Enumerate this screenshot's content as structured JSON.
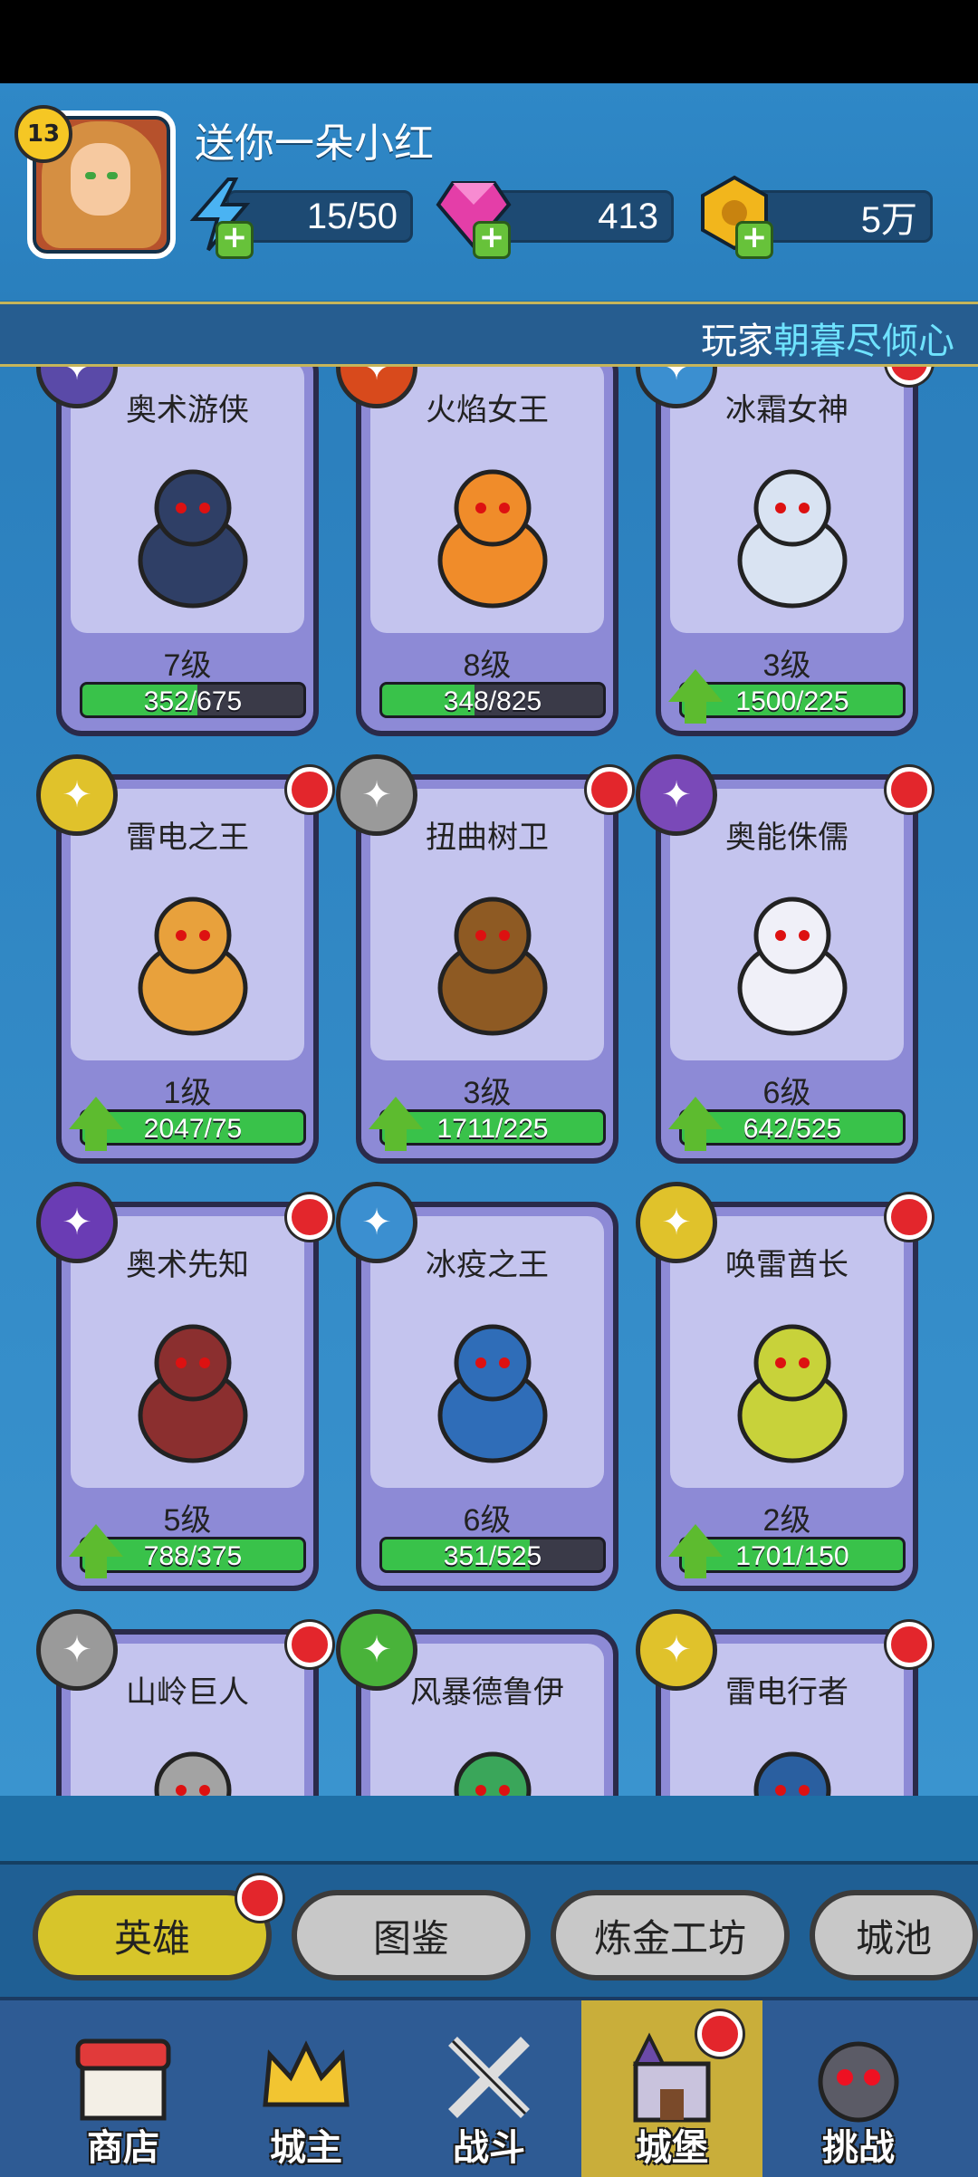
{
  "player": {
    "level": "13",
    "name": "送你一朵小红",
    "energy": "15/50",
    "gems": "413",
    "gold": "5万"
  },
  "ticker": {
    "prefix": "玩家",
    "highlight": "朝暮尽倾心"
  },
  "heroes": [
    {
      "name": "奥术游侠",
      "level": "7级",
      "progress": "352/675",
      "ratio": 0.52,
      "upgradable": false,
      "red_dot": false,
      "class_color": "#5a4aa8",
      "class_icon": "bow-icon"
    },
    {
      "name": "火焰女王",
      "level": "8级",
      "progress": "348/825",
      "ratio": 0.42,
      "upgradable": false,
      "red_dot": false,
      "class_color": "#d84a1c",
      "class_icon": "target-icon"
    },
    {
      "name": "冰霜女神",
      "level": "3级",
      "progress": "1500/225",
      "ratio": 1.0,
      "upgradable": true,
      "red_dot": true,
      "class_color": "#3b8fd0",
      "class_icon": "ice-icon"
    },
    {
      "name": "雷电之王",
      "level": "1级",
      "progress": "2047/75",
      "ratio": 1.0,
      "upgradable": true,
      "red_dot": true,
      "class_color": "#e0c22b",
      "class_icon": "lightning-icon"
    },
    {
      "name": "扭曲树卫",
      "level": "3级",
      "progress": "1711/225",
      "ratio": 1.0,
      "upgradable": true,
      "red_dot": true,
      "class_color": "#9a9a9a",
      "class_icon": "shield-icon"
    },
    {
      "name": "奥能侏儒",
      "level": "6级",
      "progress": "642/525",
      "ratio": 1.0,
      "upgradable": true,
      "red_dot": true,
      "class_color": "#7a49b8",
      "class_icon": "arcane-icon"
    },
    {
      "name": "奥术先知",
      "level": "5级",
      "progress": "788/375",
      "ratio": 1.0,
      "upgradable": true,
      "red_dot": true,
      "class_color": "#6a3cb4",
      "class_icon": "bow-icon"
    },
    {
      "name": "冰疫之王",
      "level": "6级",
      "progress": "351/525",
      "ratio": 0.67,
      "upgradable": false,
      "red_dot": false,
      "class_color": "#3b8fd0",
      "class_icon": "crystal-icon"
    },
    {
      "name": "唤雷酋长",
      "level": "2级",
      "progress": "1701/150",
      "ratio": 1.0,
      "upgradable": true,
      "red_dot": true,
      "class_color": "#e0c22b",
      "class_icon": "lightning-icon"
    },
    {
      "name": "山岭巨人",
      "level": "",
      "progress": "",
      "ratio": 0,
      "upgradable": false,
      "red_dot": true,
      "class_color": "#9a9a9a",
      "class_icon": "rock-icon"
    },
    {
      "name": "风暴德鲁伊",
      "level": "",
      "progress": "",
      "ratio": 0,
      "upgradable": false,
      "red_dot": false,
      "class_color": "#49b33a",
      "class_icon": "tornado-icon"
    },
    {
      "name": "雷电行者",
      "level": "",
      "progress": "",
      "ratio": 0,
      "upgradable": false,
      "red_dot": true,
      "class_color": "#e0c22b",
      "class_icon": "lightning-icon"
    }
  ],
  "tabs": [
    {
      "label": "英雄",
      "active": true,
      "red_dot": true
    },
    {
      "label": "图鉴",
      "active": false,
      "red_dot": false
    },
    {
      "label": "炼金工坊",
      "active": false,
      "red_dot": false
    },
    {
      "label": "城池",
      "active": false,
      "red_dot": false
    }
  ],
  "nav": [
    {
      "label": "商店",
      "icon": "shop-icon",
      "active": false,
      "red_dot": false
    },
    {
      "label": "城主",
      "icon": "crown-icon",
      "active": false,
      "red_dot": false
    },
    {
      "label": "战斗",
      "icon": "swords-icon",
      "active": false,
      "red_dot": false
    },
    {
      "label": "城堡",
      "icon": "castle-icon",
      "active": true,
      "red_dot": true
    },
    {
      "label": "挑战",
      "icon": "demon-icon",
      "active": false,
      "red_dot": false
    }
  ]
}
